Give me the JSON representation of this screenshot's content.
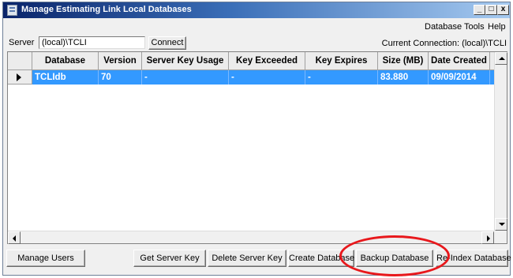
{
  "window": {
    "title": "Manage Estimating Link Local Databases",
    "controls": {
      "minimize": "_",
      "maximize": "□",
      "close": "x"
    }
  },
  "menu": [
    "Database Tools",
    "Help"
  ],
  "server": {
    "label": "Server",
    "value": "(local)\\TCLI",
    "connect_label": "Connect",
    "current_connection": "Current Connection: (local)\\TCLI"
  },
  "grid": {
    "columns": [
      "Database",
      "Version",
      "Server Key Usage",
      "Key Exceeded",
      "Key Expires",
      "Size (MB)",
      "Date Created"
    ],
    "rows": [
      [
        "TCLIdb",
        "70",
        "-",
        "-",
        "-",
        "83.880",
        "09/09/2014"
      ]
    ],
    "selected_row": 0,
    "selection_color": "#3399ff"
  },
  "buttons": {
    "manage_users": "Manage Users",
    "get_server_key": "Get Server Key",
    "delete_server_key": "Delete Server Key",
    "create_database": "Create Database",
    "backup_database": "Backup Database",
    "reindex_database": "Re-Index Database"
  },
  "annotation_color": "#e8181c"
}
